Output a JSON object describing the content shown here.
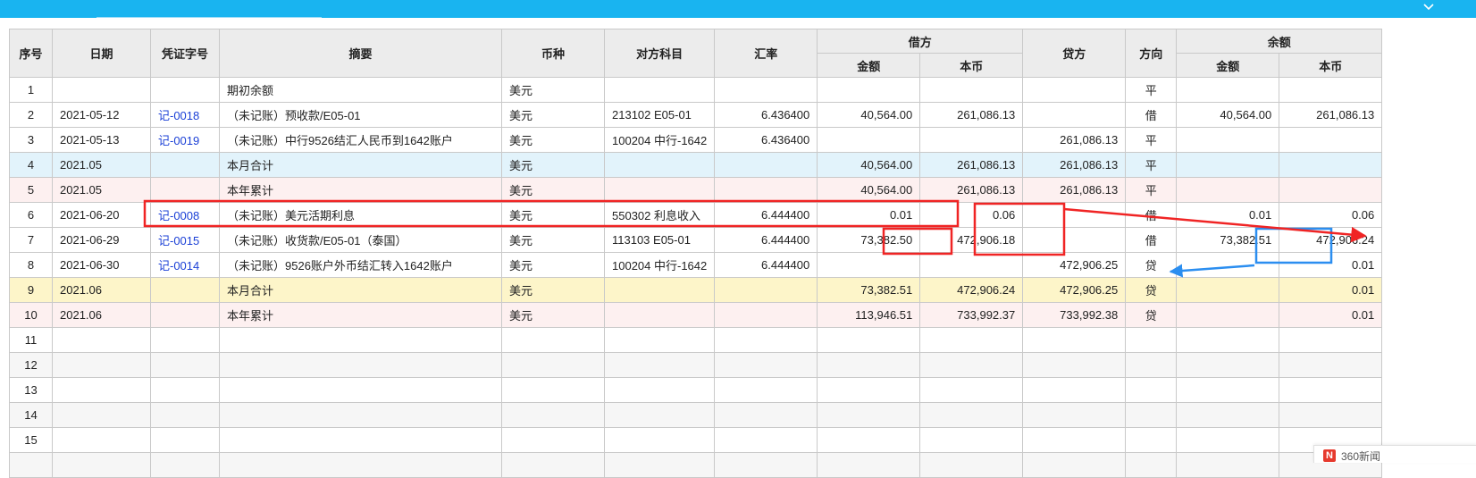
{
  "headers": {
    "seq": "序号",
    "date": "日期",
    "voucher": "凭证字号",
    "summary": "摘要",
    "currency": "币种",
    "counter": "对方科目",
    "rate": "汇率",
    "debit": "借方",
    "credit": "贷方",
    "direction": "方向",
    "balance": "余额",
    "amount": "金额",
    "local": "本币"
  },
  "rows": [
    {
      "seq": "1",
      "date": "",
      "voucher": "",
      "summary": "期初余额",
      "currency": "美元",
      "counter": "",
      "rate": "",
      "debit_amount": "",
      "debit_local": "",
      "credit": "",
      "direction": "平",
      "bal_amount": "",
      "bal_local": ""
    },
    {
      "seq": "2",
      "date": "2021-05-12",
      "voucher": "记-0018",
      "summary": "（未记账）预收款/E05-01",
      "currency": "美元",
      "counter": "213102 E05-01",
      "rate": "6.436400",
      "debit_amount": "40,564.00",
      "debit_local": "261,086.13",
      "credit": "",
      "direction": "借",
      "bal_amount": "40,564.00",
      "bal_local": "261,086.13"
    },
    {
      "seq": "3",
      "date": "2021-05-13",
      "voucher": "记-0019",
      "summary": "（未记账）中行9526结汇人民币到1642账户",
      "currency": "美元",
      "counter": "100204 中行-1642",
      "rate": "6.436400",
      "debit_amount": "",
      "debit_local": "",
      "credit": "261,086.13",
      "direction": "平",
      "bal_amount": "",
      "bal_local": ""
    },
    {
      "seq": "4",
      "date": "2021.05",
      "voucher": "",
      "summary": "本月合计",
      "currency": "美元",
      "counter": "",
      "rate": "",
      "debit_amount": "40,564.00",
      "debit_local": "261,086.13",
      "credit": "261,086.13",
      "direction": "平",
      "bal_amount": "",
      "bal_local": ""
    },
    {
      "seq": "5",
      "date": "2021.05",
      "voucher": "",
      "summary": "本年累计",
      "currency": "美元",
      "counter": "",
      "rate": "",
      "debit_amount": "40,564.00",
      "debit_local": "261,086.13",
      "credit": "261,086.13",
      "direction": "平",
      "bal_amount": "",
      "bal_local": ""
    },
    {
      "seq": "6",
      "date": "2021-06-20",
      "voucher": "记-0008",
      "summary": "（未记账）美元活期利息",
      "currency": "美元",
      "counter": "550302 利息收入",
      "rate": "6.444400",
      "debit_amount": "0.01",
      "debit_local": "0.06",
      "credit": "",
      "direction": "借",
      "bal_amount": "0.01",
      "bal_local": "0.06"
    },
    {
      "seq": "7",
      "date": "2021-06-29",
      "voucher": "记-0015",
      "summary": "（未记账）收货款/E05-01（泰国）",
      "currency": "美元",
      "counter": "113103 E05-01",
      "rate": "6.444400",
      "debit_amount": "73,382.50",
      "debit_local": "472,906.18",
      "credit": "",
      "direction": "借",
      "bal_amount": "73,382.51",
      "bal_local": "472,906.24"
    },
    {
      "seq": "8",
      "date": "2021-06-30",
      "voucher": "记-0014",
      "summary": "（未记账）9526账户外币结汇转入1642账户",
      "currency": "美元",
      "counter": "100204 中行-1642",
      "rate": "6.444400",
      "debit_amount": "",
      "debit_local": "",
      "credit": "472,906.25",
      "direction": "贷",
      "bal_amount": "",
      "bal_local": "0.01"
    },
    {
      "seq": "9",
      "date": "2021.06",
      "voucher": "",
      "summary": "本月合计",
      "currency": "美元",
      "counter": "",
      "rate": "",
      "debit_amount": "73,382.51",
      "debit_local": "472,906.24",
      "credit": "472,906.25",
      "direction": "贷",
      "bal_amount": "",
      "bal_local": "0.01"
    },
    {
      "seq": "10",
      "date": "2021.06",
      "voucher": "",
      "summary": "本年累计",
      "currency": "美元",
      "counter": "",
      "rate": "",
      "debit_amount": "113,946.51",
      "debit_local": "733,992.37",
      "credit": "733,992.38",
      "direction": "贷",
      "bal_amount": "",
      "bal_local": "0.01"
    },
    {
      "seq": "11"
    },
    {
      "seq": "12"
    },
    {
      "seq": "13"
    },
    {
      "seq": "14"
    },
    {
      "seq": "15"
    },
    {
      "seq": ""
    }
  ],
  "row_styles": [
    "",
    "",
    "",
    "blue",
    "pink",
    "",
    "",
    "",
    "yellow",
    "pink",
    "empty",
    "gray",
    "empty",
    "gray",
    "empty",
    "gray"
  ],
  "colors": {
    "topbar": "#19b4f0",
    "annotation_red": "#f02424",
    "annotation_blue": "#2b8ef0",
    "link": "#1a3fd6"
  },
  "toast": {
    "text": "360新闻",
    "logo": "N"
  }
}
